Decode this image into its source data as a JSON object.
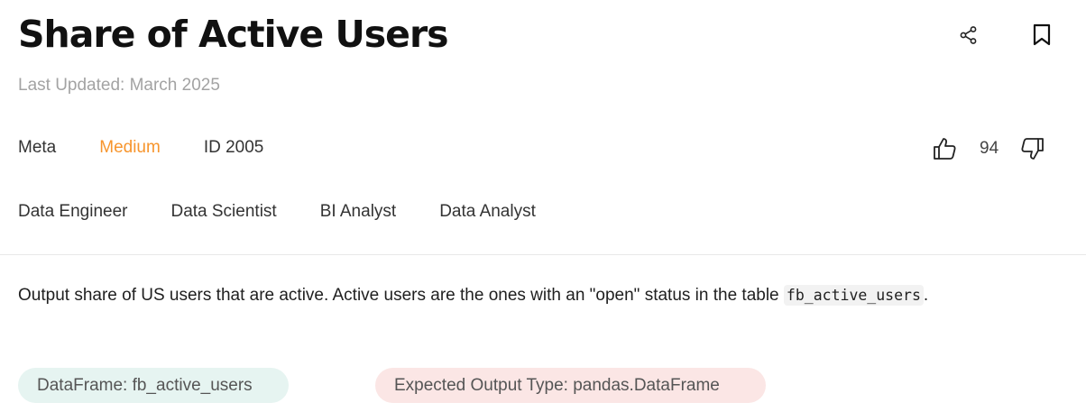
{
  "header": {
    "title": "Share of Active Users",
    "last_updated": "Last Updated: March 2025"
  },
  "actions": {
    "share_icon": "share-icon",
    "bookmark_icon": "bookmark-icon"
  },
  "meta": {
    "company": "Meta",
    "difficulty": "Medium",
    "difficulty_color": "#f7952d",
    "id_label": "ID 2005"
  },
  "votes": {
    "count": "94",
    "upvote_icon": "thumbs-up-icon",
    "downvote_icon": "thumbs-down-icon"
  },
  "roles": [
    "Data Engineer",
    "Data Scientist",
    "BI Analyst",
    "Data Analyst"
  ],
  "description": {
    "text_before": "Output share of US users that are active. Active users are the ones with an \"open\" status in the table ",
    "code": "fb_active_users",
    "text_after": "."
  },
  "tags": {
    "dataframe": "DataFrame: fb_active_users",
    "dataframe_color": "#e6f4f1",
    "output_type": "Expected Output Type: pandas.DataFrame",
    "output_type_color": "#fbe6e5"
  }
}
